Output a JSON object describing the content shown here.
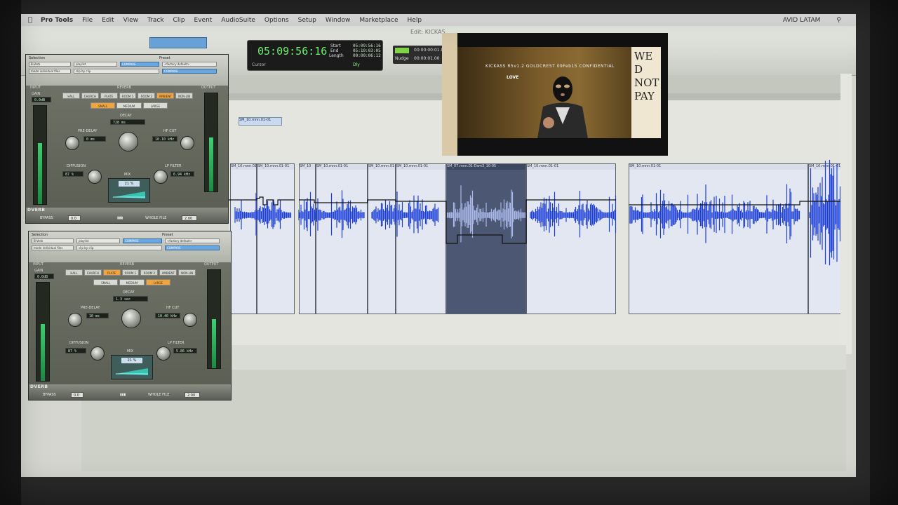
{
  "menubar": {
    "app": "Pro Tools",
    "items": [
      "File",
      "Edit",
      "View",
      "Track",
      "Clip",
      "Event",
      "AudioSuite",
      "Options",
      "Setup",
      "Window",
      "Marketplace",
      "Help"
    ],
    "user": "AVID LATAM"
  },
  "window_title": "Edit: KICKAS",
  "counter": {
    "main": "05:09:56:16",
    "start_label": "Start",
    "end_label": "End",
    "length_label": "Length",
    "start": "05:09:56:16",
    "end": "05:10:03:05",
    "length": "00:00:06:12",
    "cursor_label": "Cursor",
    "dly_label": "Dly"
  },
  "nudge": {
    "label": "Nudge",
    "value1": "00:00:00:01.00",
    "value2": "00:00:01.00"
  },
  "clips": [
    {
      "name": "SM_10.mnn.01-01"
    },
    {
      "name": "SM_10.mnn.01-01"
    },
    {
      "name": "SM_10"
    },
    {
      "name": "SM_10.mnn.01-01"
    },
    {
      "name": "SM_10.mnn.01-01"
    },
    {
      "name": "SM_10.mnn.01-01"
    },
    {
      "name": "SM_07.mnn.01-Dwn3_10-05"
    },
    {
      "name": "SM_10.mnn.01-01"
    },
    {
      "name": "SM_10.mnn.01-01"
    },
    {
      "name": "SM_10.mnn.01-01"
    }
  ],
  "track_label": "SM_10.mnn.01-01",
  "video": {
    "overlay": "KICKASS  R5v1.2  GOLDCREST  09Feb15  CONFIDENTIAL",
    "sign_text": "WE D NOT PAY",
    "logo": "LOVE"
  },
  "plugins": [
    {
      "selection_label": "Selection",
      "preset_label": "Preset",
      "bypass_chip": "B-Verb",
      "playlist": "playlist",
      "compare": "COMPARE",
      "factory_default": "<factory default>",
      "mode": "mode individual files",
      "clip_by_clip": "clip by clip",
      "input_label": "INPUT",
      "output_label": "OUTPUT",
      "reverb_label": "REVERB",
      "gain_label": "GAIN",
      "gain_value": "0.0dB",
      "modes": [
        "HALL",
        "CHURCH",
        "PLATE",
        "ROOM 1",
        "ROOM 2",
        "AMBIENT",
        "NON-LIN"
      ],
      "active_mode": 5,
      "sizes": [
        "SMALL",
        "MEDIUM",
        "LARGE"
      ],
      "active_size": 0,
      "decay_label": "DECAY",
      "decay_value": "728 ms",
      "predelay_label": "PRE-DELAY",
      "predelay_value": "0 ms",
      "hfcut_label": "HF CUT",
      "hfcut_value": "10.10 kHz",
      "diffusion_label": "DIFFUSION",
      "diffusion_value": "87 %",
      "lpfilter_label": "LP FILTER",
      "lpfilter_value": "6.94 kHz",
      "mix_label": "MIX",
      "mix_value": "21 %",
      "plugin_name": "DVERB",
      "bypass_label": "BYPASS",
      "bypass_value": "0.0",
      "whole_file_label": "WHOLE FILE",
      "whole_file_value": "2.00",
      "input_meter": 0.62,
      "output_meter": 0.55
    },
    {
      "selection_label": "Selection",
      "preset_label": "Preset",
      "bypass_chip": "B-Verb",
      "playlist": "playlist",
      "compare": "COMPARE",
      "factory_default": "<factory default>",
      "mode": "mode individual files",
      "clip_by_clip": "clip by clip",
      "input_label": "INPUT",
      "output_label": "OUTPUT",
      "reverb_label": "REVERB",
      "gain_label": "GAIN",
      "gain_value": "0.0dB",
      "modes": [
        "HALL",
        "CHURCH",
        "PLATE",
        "ROOM 1",
        "ROOM 2",
        "AMBIENT",
        "NON-LIN"
      ],
      "active_mode": 2,
      "sizes": [
        "SMALL",
        "MEDIUM",
        "LARGE"
      ],
      "active_size": 2,
      "decay_label": "DECAY",
      "decay_value": "1.3 sec",
      "predelay_label": "PRE-DELAY",
      "predelay_value": "10 ms",
      "hfcut_label": "HF CUT",
      "hfcut_value": "10.40 kHz",
      "diffusion_label": "DIFFUSION",
      "diffusion_value": "87 %",
      "lpfilter_label": "LP FILTER",
      "lpfilter_value": "5.86 kHz",
      "mix_label": "MIX",
      "mix_value": "21 %",
      "plugin_name": "DVERB",
      "bypass_label": "BYPASS",
      "bypass_value": "0.0",
      "whole_file_label": "WHOLE FILE",
      "whole_file_value": "2.00",
      "input_meter": 0.58,
      "output_meter": 0.5
    }
  ],
  "colors": {
    "waveform": "#1d3fd6",
    "selected_waveform": "#aab7e8",
    "counter_green": "#6ef06e",
    "active_button": "#f2a43a"
  }
}
